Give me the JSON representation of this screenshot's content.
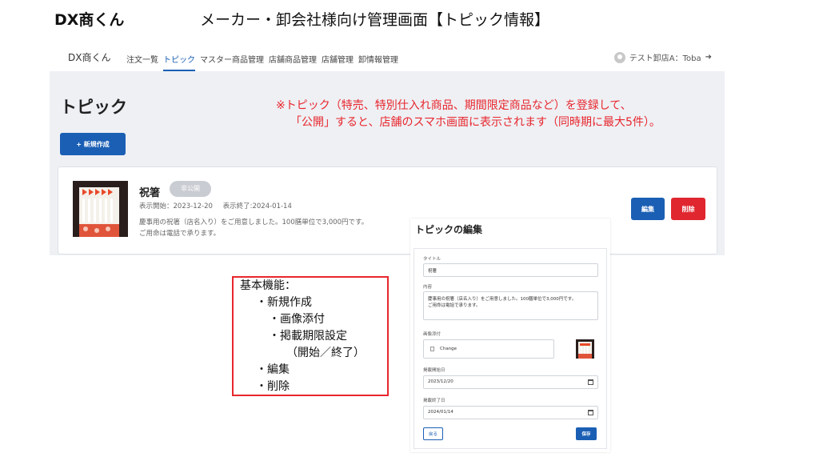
{
  "slide": {
    "brand": "DX商くん",
    "title": "メーカー・卸会社様向け管理画面【トピック情報】"
  },
  "nav": {
    "brand": "DX商くん",
    "links": [
      "注文一覧",
      "トピック",
      "マスター商品管理",
      "店舗商品管理",
      "店舗管理",
      "卸情報管理"
    ],
    "active_link": "トピック",
    "user": "テスト卸店A：Toba"
  },
  "page": {
    "title": "トピック",
    "new_button": "+ 新規作成"
  },
  "annotation": {
    "line1": "※トピック（特売、特別仕入れ商品、期間限定商品など）を登録して、",
    "line2": "「公開」すると、店舗のスマホ画面に表示されます（同時期に最大5件）。"
  },
  "topic": {
    "title": "祝箸",
    "status": "非公開",
    "start": "表示開始：2023-12-20",
    "end": "表示終了:2024-01-14",
    "desc_line1": "慶事用の祝箸（店名入り）をご用意しました。100膳単位で3,000円です。",
    "desc_line2": "ご用命は電話で承ります。",
    "edit_button": "編集",
    "delete_button": "削除"
  },
  "features": {
    "heading": "基本機能：",
    "items": [
      "・新規作成",
      "・画像添付",
      "・掲載期限設定",
      "（開始／終了）",
      "・編集",
      "・削除"
    ]
  },
  "edit_panel": {
    "title": "トピックの編集",
    "title_label": "タイトル",
    "title_value": "祝箸",
    "content_label": "内容",
    "content_line1": "慶事用の祝箸（店名入り）をご用意しました。100膳単位で3,000円です。",
    "content_line2": "ご用命は電話で承ります。",
    "image_label": "画像添付",
    "file_button": "Change",
    "start_label": "掲載開始日",
    "start_value": "2023/12/20",
    "end_label": "掲載終了日",
    "end_value": "2024/01/14",
    "back_button": "戻る",
    "save_button": "保存"
  },
  "colors": {
    "primary": "#1a5fb4",
    "danger": "#e0262e",
    "annotation": "#e8262d",
    "page_bg": "#eef0f4"
  }
}
